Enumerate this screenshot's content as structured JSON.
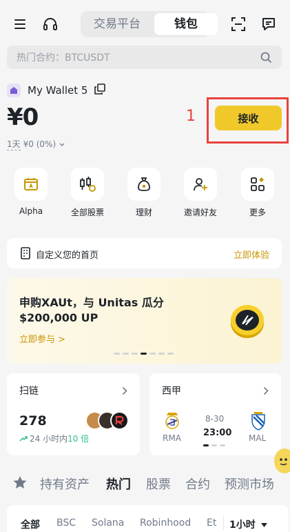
{
  "header": {
    "segment": {
      "inactive_label": "交易平台",
      "active_label": "钱包"
    },
    "icons": [
      "menu-icon",
      "headset-icon",
      "scan-icon",
      "message-icon"
    ]
  },
  "search": {
    "placeholder": "热门合约：BTCUSDT"
  },
  "wallet": {
    "name": "My Wallet 5",
    "balance": "¥0",
    "period": "1天",
    "change": "¥0 (0%)"
  },
  "annotation": {
    "marker": "1"
  },
  "receive_button": {
    "label": "接收",
    "color": "#f0c829"
  },
  "quick_actions": [
    {
      "label": "Alpha",
      "icon": "alpha-icon"
    },
    {
      "label": "全部股票",
      "icon": "stocks-icon"
    },
    {
      "label": "理财",
      "icon": "earn-icon"
    },
    {
      "label": "邀请好友",
      "icon": "invite-icon"
    },
    {
      "label": "更多",
      "icon": "more-icon"
    }
  ],
  "customize": {
    "text": "自定义您的首页",
    "cta": "立即体验"
  },
  "banner": {
    "line1": "申购XAUt，与 Unitas 瓜分",
    "line2": "$200,000 UP",
    "link": "立即参与 >",
    "active_slide": 4,
    "slide_count": 7
  },
  "scan_card": {
    "title": "扫链",
    "value": "278",
    "subtitle_prefix": "24 小时内",
    "subtitle_highlight": "10 倍"
  },
  "match_card": {
    "title": "西甲",
    "home": "RMA",
    "away": "MAL",
    "date": "8-30",
    "time": "23:00"
  },
  "tabs": [
    "持有资产",
    "热门",
    "股票",
    "合约",
    "预测市场"
  ],
  "active_tab": "热门",
  "filters": [
    "全部",
    "BSC",
    "Solana",
    "Robinhood",
    "Et"
  ],
  "time_filter": "1小时",
  "colors": {
    "accent": "#f0c829",
    "accent_text": "#c99400",
    "positive": "#2ebd85",
    "annotation": "#e8423e"
  }
}
